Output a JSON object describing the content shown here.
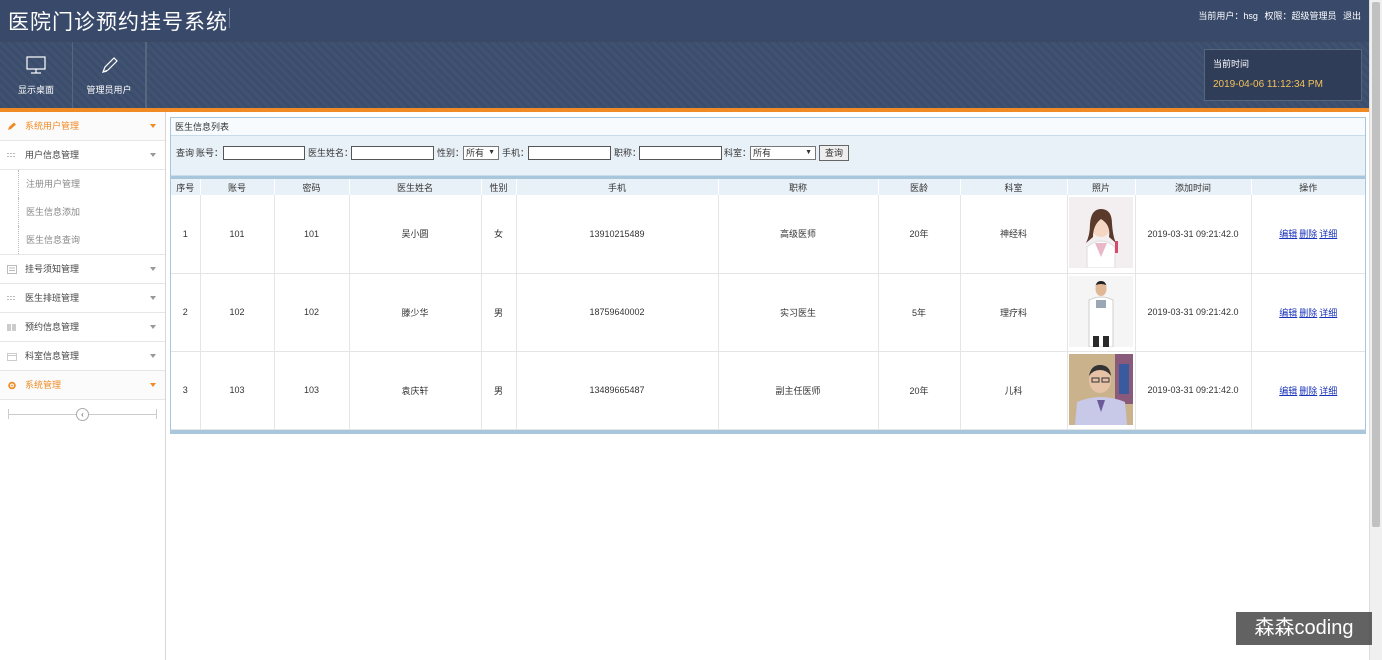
{
  "header": {
    "title": "医院门诊预约挂号系统",
    "user_label": "当前用户：hsg",
    "role_label": "权限：超级管理员",
    "logout_label": "退出",
    "nav": [
      {
        "label": "显示桌面",
        "icon": "monitor-icon"
      },
      {
        "label": "管理员用户",
        "icon": "pencil-icon"
      }
    ],
    "time_box": {
      "label": "当前时间",
      "value": "2019-04-06 11:12:34 PM"
    }
  },
  "sidebar": {
    "groups": [
      {
        "label": "系统用户管理",
        "icon": "pencil-icon",
        "active": true
      },
      {
        "label": "用户信息管理",
        "icon": "list-icon",
        "active": false,
        "children": [
          "注册用户管理",
          "医生信息添加",
          "医生信息查询"
        ]
      },
      {
        "label": "挂号须知管理",
        "icon": "document-icon",
        "active": false
      },
      {
        "label": "医生排班管理",
        "icon": "list-icon",
        "active": false
      },
      {
        "label": "预约信息管理",
        "icon": "grid-icon",
        "active": false
      },
      {
        "label": "科室信息管理",
        "icon": "calendar-icon",
        "active": false
      },
      {
        "label": "系统管理",
        "icon": "gear-icon",
        "active": true
      }
    ],
    "collapse_icon": "‹"
  },
  "panel": {
    "title": "医生信息列表",
    "query": {
      "prefix": "查询",
      "account_label": "账号：",
      "name_label": "医生姓名：",
      "gender_label": "性别：",
      "gender_value": "所有",
      "phone_label": "手机：",
      "title_label": "职称：",
      "dept_label": "科室：",
      "dept_value": "所有",
      "button": "查询"
    },
    "columns": [
      "序号",
      "账号",
      "密码",
      "医生姓名",
      "性别",
      "手机",
      "职称",
      "医龄",
      "科室",
      "照片",
      "添加时间",
      "操作"
    ],
    "rows": [
      {
        "no": "1",
        "account": "101",
        "password": "101",
        "name": "吴小圆",
        "gender": "女",
        "phone": "13910215489",
        "title": "高级医师",
        "years": "20年",
        "dept": "神经科",
        "photo": "female-doctor-photo",
        "time": "2019-03-31 09:21:42.0"
      },
      {
        "no": "2",
        "account": "102",
        "password": "102",
        "name": "滕少华",
        "gender": "男",
        "phone": "18759640002",
        "title": "实习医生",
        "years": "5年",
        "dept": "理疗科",
        "photo": "male-doctor-photo",
        "time": "2019-03-31 09:21:42.0"
      },
      {
        "no": "3",
        "account": "103",
        "password": "103",
        "name": "袁庆轩",
        "gender": "男",
        "phone": "13489665487",
        "title": "副主任医师",
        "years": "20年",
        "dept": "儿科",
        "photo": "senior-doctor-photo",
        "time": "2019-03-31 09:21:42.0"
      }
    ],
    "ops": {
      "edit": "编辑",
      "delete": "删除",
      "detail": "详细"
    }
  },
  "watermark": "森森coding",
  "colors": {
    "header_bg": "#3a4a66",
    "accent": "#f08a24",
    "panel_border": "#a8c7dd",
    "time_text": "#f4c25a"
  }
}
